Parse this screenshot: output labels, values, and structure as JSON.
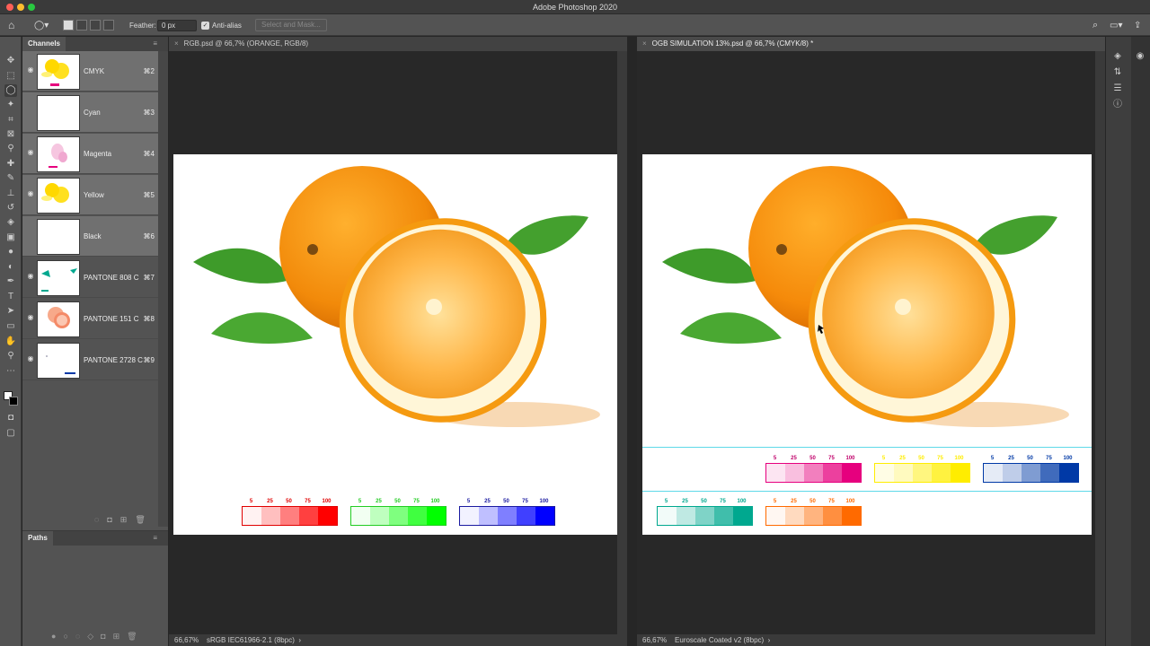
{
  "app": {
    "title": "Adobe Photoshop 2020"
  },
  "options_bar": {
    "feather_label": "Feather:",
    "feather_value": "0 px",
    "anti_alias_label": "Anti-alias",
    "select_mask_label": "Select and Mask..."
  },
  "channels_panel": {
    "tab_label": "Channels",
    "channels": [
      {
        "name": "CMYK",
        "shortcut": "⌘2"
      },
      {
        "name": "Cyan",
        "shortcut": "⌘3"
      },
      {
        "name": "Magenta",
        "shortcut": "⌘4"
      },
      {
        "name": "Yellow",
        "shortcut": "⌘5"
      },
      {
        "name": "Black",
        "shortcut": "⌘6"
      },
      {
        "name": "PANTONE 808 C",
        "shortcut": "⌘7"
      },
      {
        "name": "PANTONE 151 C",
        "shortcut": "⌘8"
      },
      {
        "name": "PANTONE 2728 C",
        "shortcut": "⌘9"
      }
    ]
  },
  "paths_panel": {
    "tab_label": "Paths"
  },
  "documents": [
    {
      "tab_label": "RGB.psd @ 66,7% (ORANGE, RGB/8)",
      "zoom": "66,67%",
      "profile": "sRGB IEC61966-2.1 (8bpc)"
    },
    {
      "tab_label": "OGB SIMULATION 13%.psd @ 66,7% (CMYK/8) *",
      "zoom": "66,67%",
      "profile": "Euroscale Coated v2 (8bpc)"
    }
  ],
  "swatch_labels": [
    "5",
    "25",
    "50",
    "75",
    "100"
  ],
  "colors": {
    "red": "#ff0000",
    "green": "#00ff00",
    "blue": "#0000ff",
    "magenta": "#e6007e",
    "yellow": "#ffed00",
    "process_blue": "#0039a6",
    "teal": "#00a88f",
    "orange": "#ff6a00"
  }
}
